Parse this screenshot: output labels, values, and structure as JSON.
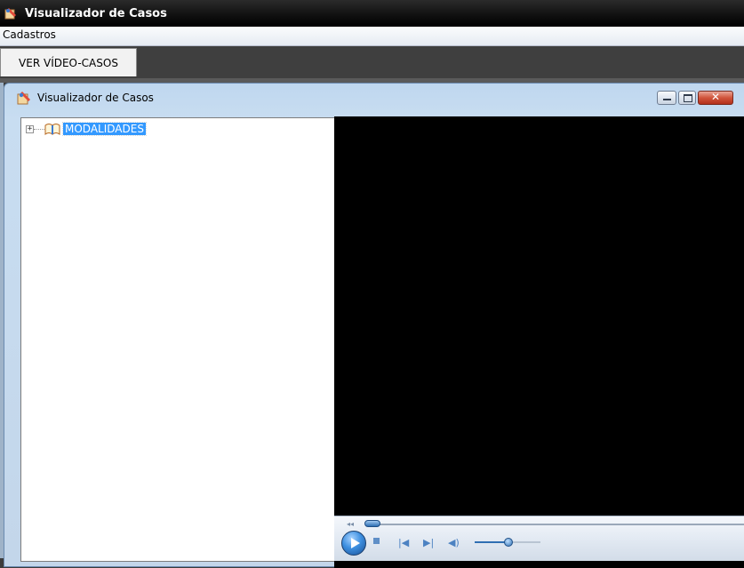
{
  "window": {
    "title": "Visualizador de Casos"
  },
  "menubar": {
    "items": [
      {
        "label": "Cadastros"
      }
    ]
  },
  "tabs": [
    {
      "label": "VER VÍDEO-CASOS",
      "selected": true
    }
  ],
  "child_window": {
    "title": "Visualizador de Casos",
    "buttons": {
      "minimize": "minimize-icon",
      "maximize": "maximize-icon",
      "close": "close-icon"
    }
  },
  "tree": {
    "nodes": [
      {
        "label": "MODALIDADES",
        "expander": "+",
        "icon": "book-icon",
        "selected": true
      }
    ]
  },
  "player": {
    "background": "#000000",
    "controls": {
      "seek_position": 0.0,
      "volume_level": 0.5,
      "icons": [
        "rewind-icon",
        "play-icon",
        "stop-icon",
        "previous-icon",
        "next-icon",
        "volume-icon"
      ]
    }
  },
  "colors": {
    "selection": "#3399ff",
    "title_bar": "#000000",
    "child_frame": "#c8ddf1"
  }
}
